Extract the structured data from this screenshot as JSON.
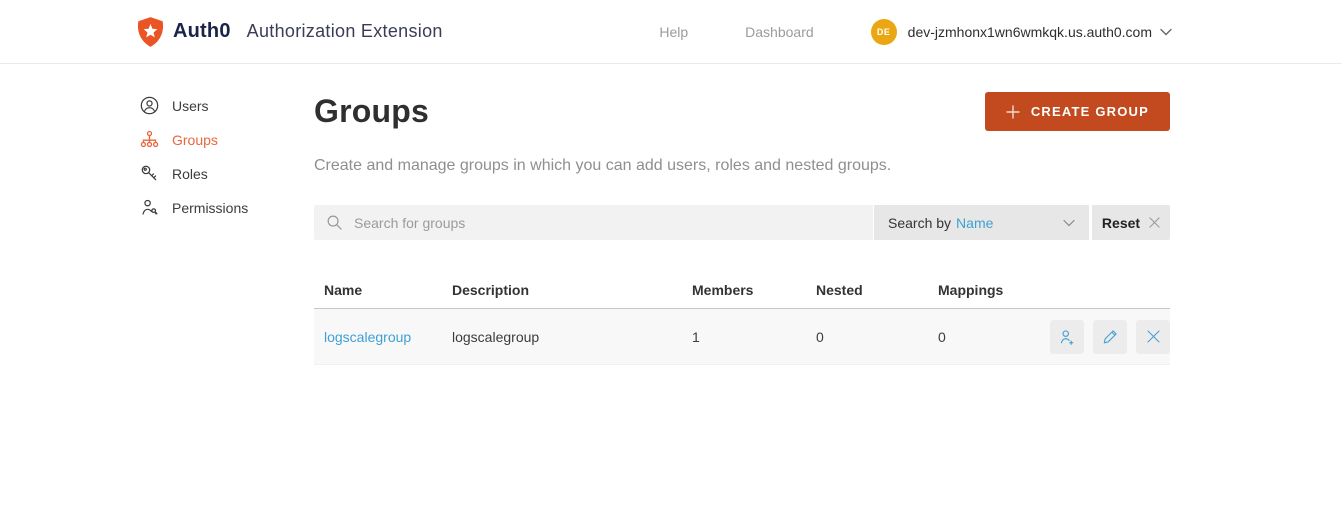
{
  "header": {
    "brand": "Auth0",
    "app_title": "Authorization Extension",
    "nav": {
      "help": "Help",
      "dashboard": "Dashboard"
    },
    "account": {
      "initials": "DE",
      "tenant": "dev-jzmhonx1wn6wmkqk.us.auth0.com"
    }
  },
  "sidebar": {
    "active": "Groups",
    "items": [
      {
        "label": "Users",
        "icon": "user-circle-icon"
      },
      {
        "label": "Groups",
        "icon": "org-chart-icon"
      },
      {
        "label": "Roles",
        "icon": "keys-icon"
      },
      {
        "label": "Permissions",
        "icon": "user-key-icon"
      }
    ]
  },
  "main": {
    "title": "Groups",
    "create_button": "CREATE GROUP",
    "description": "Create and manage groups in which you can add users, roles and nested groups.",
    "search": {
      "placeholder": "Search for groups",
      "search_by_label": "Search by",
      "search_by_value": "Name",
      "reset_label": "Reset"
    },
    "table": {
      "columns": [
        "Name",
        "Description",
        "Members",
        "Nested",
        "Mappings"
      ],
      "rows": [
        {
          "name": "logscalegroup",
          "description": "logscalegroup",
          "members": "1",
          "nested": "0",
          "mappings": "0",
          "actions": [
            "add-member-icon",
            "edit-icon",
            "delete-icon"
          ]
        }
      ]
    }
  },
  "colors": {
    "brand_orange": "#eb5424",
    "button_orange": "#c24a1e",
    "sidebar_active_orange": "#e8673f",
    "link_blue": "#3ea0d4",
    "action_icon_blue": "#4aa0d5",
    "avatar_amber": "#eaa711",
    "brand_navy": "#1b2448"
  }
}
